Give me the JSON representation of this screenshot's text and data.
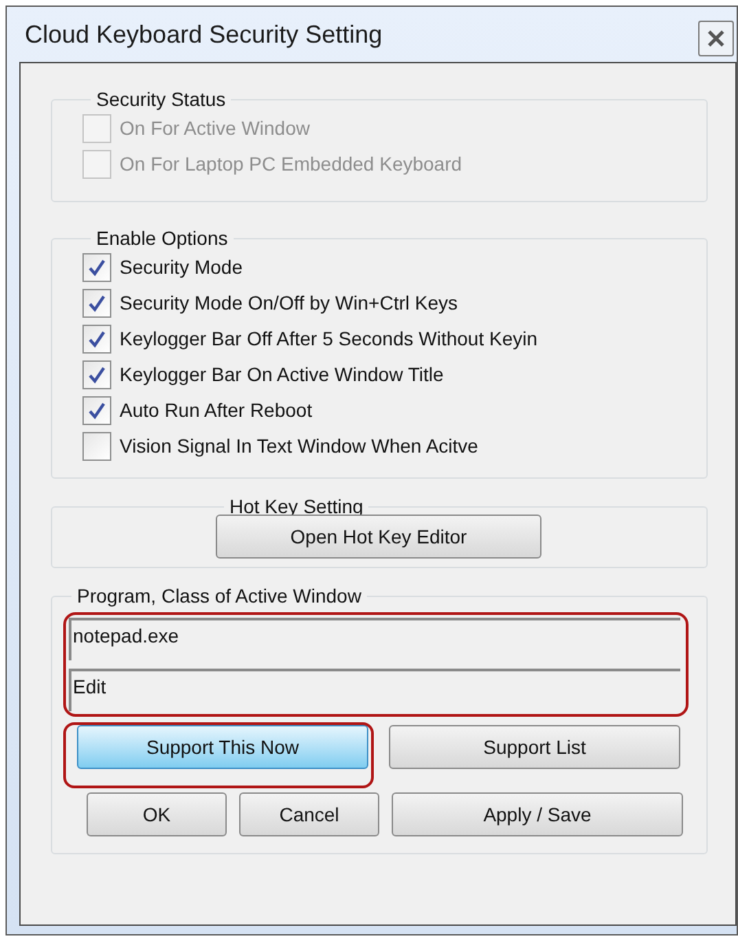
{
  "window": {
    "title": "Cloud Keyboard Security Setting"
  },
  "security_status": {
    "title": "Security Status",
    "options": [
      {
        "label": "On For Active Window",
        "checked": false,
        "disabled": true
      },
      {
        "label": "On For Laptop PC Embedded Keyboard",
        "checked": false,
        "disabled": true
      }
    ]
  },
  "enable_options": {
    "title": "Enable Options",
    "options": [
      {
        "label": "Security Mode",
        "checked": true,
        "disabled": false
      },
      {
        "label": "Security Mode On/Off by Win+Ctrl Keys",
        "checked": true,
        "disabled": false
      },
      {
        "label": "Keylogger Bar Off After 5 Seconds Without Keyin",
        "checked": true,
        "disabled": false
      },
      {
        "label": "Keylogger Bar On Active Window Title",
        "checked": true,
        "disabled": false
      },
      {
        "label": "Auto Run After Reboot",
        "checked": true,
        "disabled": false
      },
      {
        "label": "Vision Signal In Text Window When Acitve",
        "checked": false,
        "disabled": false
      }
    ]
  },
  "hot_key": {
    "title": "Hot Key Setting",
    "button": "Open Hot Key Editor"
  },
  "program_class": {
    "title": "Program, Class of Active Window",
    "highlighted": true,
    "fields": [
      {
        "value": "notepad.exe"
      },
      {
        "value": "Edit"
      }
    ],
    "support_buttons": [
      {
        "label": "Support This Now",
        "focused": true,
        "highlighted": true
      },
      {
        "label": "Support List",
        "focused": false,
        "highlighted": false
      }
    ],
    "buttons": [
      {
        "label": "OK"
      },
      {
        "label": "Cancel"
      },
      {
        "label": "Apply / Save"
      }
    ]
  }
}
